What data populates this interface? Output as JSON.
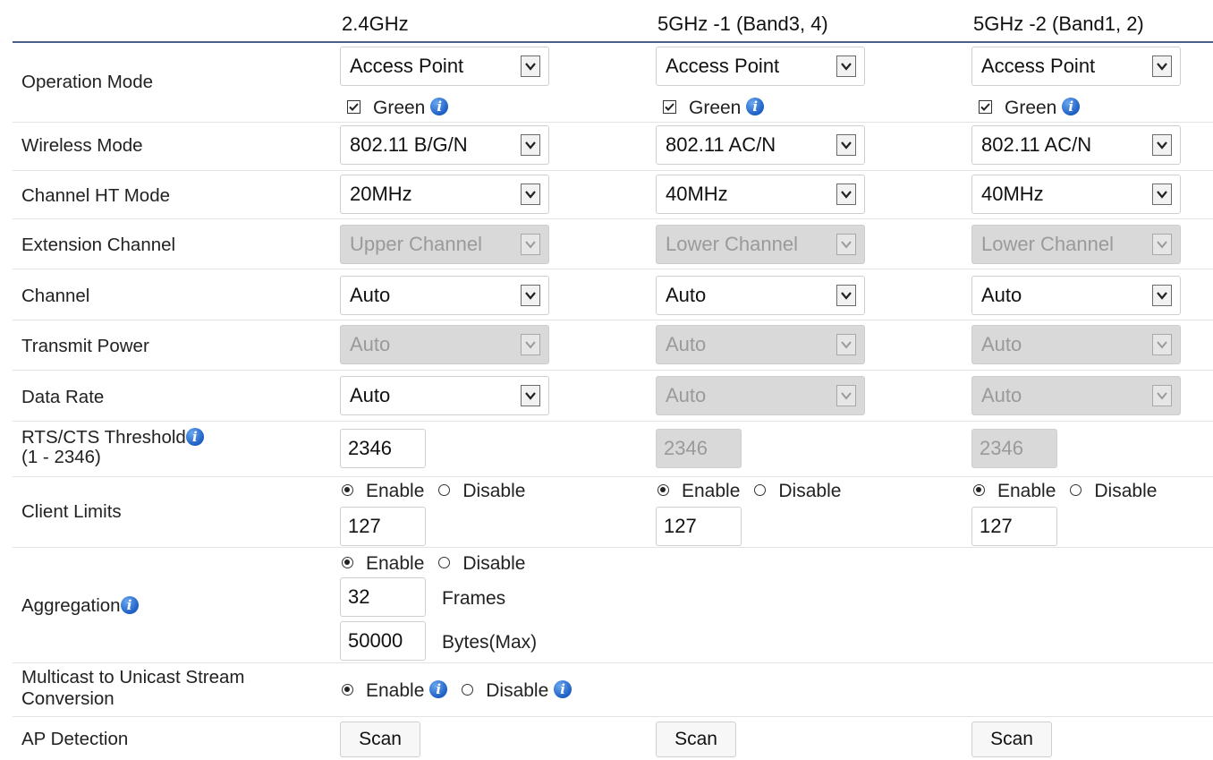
{
  "columns": [
    "2.4GHz",
    "5GHz -1 (Band3, 4)",
    "5GHz -2 (Band1, 2)"
  ],
  "labels": {
    "operation_mode": "Operation Mode",
    "wireless_mode": "Wireless Mode",
    "channel_ht_mode": "Channel HT Mode",
    "extension_channel": "Extension Channel",
    "channel": "Channel",
    "transmit_power": "Transmit Power",
    "data_rate": "Data Rate",
    "rts_cts_threshold": "RTS/CTS Threshold",
    "rts_cts_range": "(1 - 2346)",
    "client_limits": "Client Limits",
    "aggregation": "Aggregation",
    "multicast_line1": "Multicast to Unicast Stream",
    "multicast_line2": "Conversion",
    "ap_detection": "AP Detection"
  },
  "bands": [
    {
      "operation_mode": "Access Point",
      "green_label": "Green",
      "green_checked": true,
      "wireless_mode": "802.11 B/G/N",
      "channel_ht_mode": "20MHz",
      "extension_channel": "Upper Channel",
      "channel": "Auto",
      "transmit_power": "Auto",
      "data_rate": "Auto",
      "rts_cts_threshold": "2346",
      "client_limits_enable": "Enable",
      "client_limits_disable": "Disable",
      "client_limits_value": "127",
      "scan_label": "Scan"
    },
    {
      "operation_mode": "Access Point",
      "green_label": "Green",
      "green_checked": true,
      "wireless_mode": "802.11 AC/N",
      "channel_ht_mode": "40MHz",
      "extension_channel": "Lower Channel",
      "channel": "Auto",
      "transmit_power": "Auto",
      "data_rate": "Auto",
      "rts_cts_threshold": "2346",
      "client_limits_enable": "Enable",
      "client_limits_disable": "Disable",
      "client_limits_value": "127",
      "scan_label": "Scan"
    },
    {
      "operation_mode": "Access Point",
      "green_label": "Green",
      "green_checked": true,
      "wireless_mode": "802.11 AC/N",
      "channel_ht_mode": "40MHz",
      "extension_channel": "Lower Channel",
      "channel": "Auto",
      "transmit_power": "Auto",
      "data_rate": "Auto",
      "rts_cts_threshold": "2346",
      "client_limits_enable": "Enable",
      "client_limits_disable": "Disable",
      "client_limits_value": "127",
      "scan_label": "Scan"
    }
  ],
  "aggregation": {
    "enable": "Enable",
    "disable": "Disable",
    "frames_value": "32",
    "frames_unit": "Frames",
    "bytes_value": "50000",
    "bytes_unit": "Bytes(Max)"
  },
  "multicast": {
    "enable": "Enable",
    "disable": "Disable"
  },
  "info_glyph": "i"
}
